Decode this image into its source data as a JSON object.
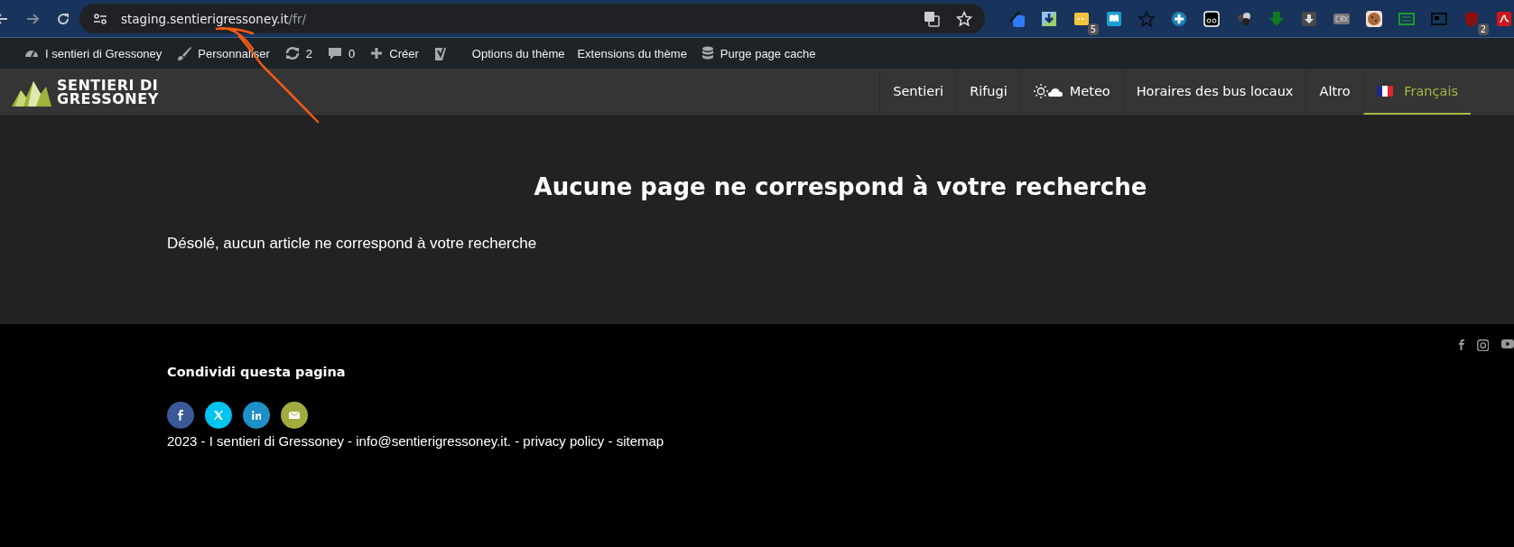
{
  "browser": {
    "url_host": "staging.sentierigressoney.it",
    "url_path": "/fr/",
    "extensions": [
      {
        "kind": "eyedropper"
      },
      {
        "kind": "download"
      },
      {
        "kind": "ticket",
        "badge": "5"
      },
      {
        "kind": "book"
      },
      {
        "kind": "star"
      },
      {
        "kind": "plus"
      },
      {
        "kind": "eyes"
      },
      {
        "kind": "balls"
      },
      {
        "kind": "greendown"
      },
      {
        "kind": "greydown"
      },
      {
        "kind": "crx"
      },
      {
        "kind": "cookie"
      },
      {
        "kind": "card"
      },
      {
        "kind": "news"
      },
      {
        "kind": "shield",
        "badge": "2"
      },
      {
        "kind": "pdf"
      }
    ]
  },
  "admin_bar": {
    "items": [
      {
        "kind": "dashboard",
        "label": "I sentieri di Gressoney"
      },
      {
        "kind": "brush",
        "label": "Personnaliser"
      },
      {
        "kind": "updates",
        "label": "2"
      },
      {
        "kind": "comments",
        "label": "0"
      },
      {
        "kind": "plus",
        "label": "Créer"
      },
      {
        "kind": "yoast"
      },
      {
        "kind": "text",
        "label": "Options du thème"
      },
      {
        "kind": "text",
        "label": "Extensions du thème"
      },
      {
        "kind": "database",
        "label": "Purge page cache"
      }
    ]
  },
  "site": {
    "logo": [
      "SENTIERI DI",
      "GRESSONEY"
    ],
    "nav": [
      {
        "label": "Sentieri",
        "kind": "text",
        "selected": false
      },
      {
        "label": "Rifugi",
        "kind": "text",
        "selected": false
      },
      {
        "label": "Meteo",
        "kind": "weather",
        "selected": false
      },
      {
        "label": "Horaires des bus locaux",
        "kind": "text",
        "selected": false
      },
      {
        "label": "Altro",
        "kind": "text",
        "selected": false
      },
      {
        "label": "Français",
        "kind": "flag",
        "selected": true
      }
    ]
  },
  "content": {
    "title": "Aucune page ne correspond à votre recherche",
    "message": "Désolé, aucun article ne correspond à votre recherche"
  },
  "footer": {
    "social": [
      {
        "kind": "facebook"
      },
      {
        "kind": "instagram"
      },
      {
        "kind": "youtube"
      }
    ],
    "share_title": "Condividi questa pagina",
    "share_buttons": [
      {
        "kind": "facebook",
        "color": "#3b5998"
      },
      {
        "kind": "x",
        "color": "#00c4f0"
      },
      {
        "kind": "linkedin",
        "color": "#1e8fc8"
      },
      {
        "kind": "email",
        "color": "#a2ac3e"
      }
    ],
    "copyright": {
      "text": "2023 - I sentieri di Gressoney - ",
      "separator": " - ",
      "links": [
        "info@sentierigressoney.it.",
        "privacy policy",
        "sitemap"
      ]
    }
  }
}
